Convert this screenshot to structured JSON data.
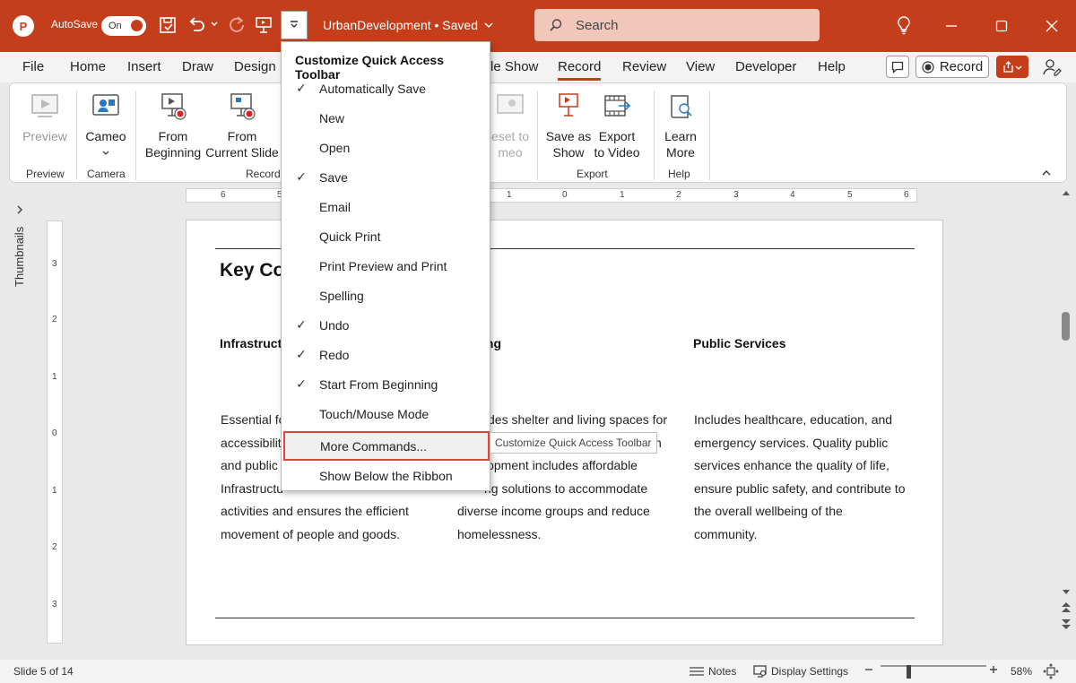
{
  "titlebar": {
    "app_logo": "P",
    "autosave_label": "AutoSave",
    "autosave_state": "On",
    "doc_title": "UrbanDevelopment • Saved",
    "search_placeholder": "Search"
  },
  "tabs": {
    "file": "File",
    "home": "Home",
    "insert": "Insert",
    "draw": "Draw",
    "design": "Design",
    "slideshow_partial": "le Show",
    "record": "Record",
    "review": "Review",
    "view": "View",
    "developer": "Developer",
    "help": "Help",
    "record_button": "Record"
  },
  "ribbon": {
    "preview": "Preview",
    "cameo": "Cameo",
    "from_beginning_1": "From",
    "from_beginning_2": "Beginning",
    "from_current_1": "From",
    "from_current_2": "Current Slide",
    "reset_1": "eset to",
    "reset_2": "meo",
    "save_show_1": "Save as",
    "save_show_2": "Show",
    "export_video_1": "Export",
    "export_video_2": "to Video",
    "learn_more_1": "Learn",
    "learn_more_2": "More",
    "groups": {
      "preview": "Preview",
      "camera": "Camera",
      "record": "Record",
      "export": "Export",
      "help": "Help"
    }
  },
  "ruler": {
    "h_ticks": [
      "6",
      "5",
      "1",
      "0",
      "1",
      "2",
      "3",
      "4",
      "5",
      "6"
    ],
    "v_ticks": [
      "3",
      "2",
      "1",
      "0",
      "1",
      "2",
      "3"
    ]
  },
  "thumbnails_label": "Thumbnails",
  "slide": {
    "title": "Key Co",
    "col1_head": "Infrastruct",
    "col2_head": "ing",
    "col3_head": "Public Services",
    "col1_lines": [
      "Essential fo",
      "accessibilit",
      "and public",
      "Infrastructu",
      "activities and ensures the efficient",
      "movement of people and goods."
    ],
    "col2_lines": [
      "des shelter and living spaces for",
      "n",
      "lopment includes affordable",
      "ng solutions to accommodate",
      "diverse income groups and reduce",
      "homelessness."
    ],
    "col3_lines": [
      "Includes healthcare, education, and",
      "emergency services. Quality public",
      "services enhance the quality of life,",
      "ensure public safety, and contribute to",
      "the overall wellbeing of the",
      "community."
    ]
  },
  "qat_menu": {
    "header": "Customize Quick Access Toolbar",
    "items": [
      {
        "label": "Automatically Save",
        "checked": "✓"
      },
      {
        "label": "New",
        "checked": ""
      },
      {
        "label": "Open",
        "checked": ""
      },
      {
        "label": "Save",
        "checked": "✓"
      },
      {
        "label": "Email",
        "checked": ""
      },
      {
        "label": "Quick Print",
        "checked": ""
      },
      {
        "label": "Print Preview and Print",
        "checked": ""
      },
      {
        "label": "Spelling",
        "checked": ""
      },
      {
        "label": "Undo",
        "checked": "✓"
      },
      {
        "label": "Redo",
        "checked": "✓"
      },
      {
        "label": "Start From Beginning",
        "checked": "✓"
      },
      {
        "label": "Touch/Mouse Mode",
        "checked": ""
      },
      {
        "label": "More Commands...",
        "checked": ""
      },
      {
        "label": "Show Below the Ribbon",
        "checked": ""
      }
    ],
    "tooltip": "Customize Quick Access Toolbar"
  },
  "statusbar": {
    "slide_count": "Slide 5 of 14",
    "notes": "Notes",
    "display_settings": "Display Settings",
    "zoom": "58%"
  },
  "colors": {
    "accent": "#c43e1c",
    "highlight_border": "#e0453a"
  }
}
